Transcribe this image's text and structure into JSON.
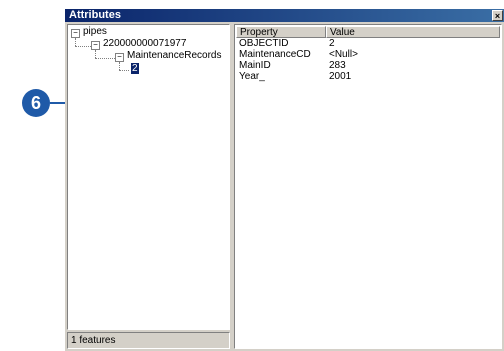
{
  "callout": {
    "number": "6"
  },
  "window": {
    "title": "Attributes",
    "close_glyph": "×"
  },
  "tree": {
    "root": {
      "label": "pipes",
      "expander": "−"
    },
    "feature": {
      "label": "220000000071977",
      "expander": "−"
    },
    "relationship": {
      "label": "MaintenanceRecords",
      "expander": "−"
    },
    "record": {
      "label": "2"
    }
  },
  "status": {
    "text": "1 features"
  },
  "properties": {
    "headers": {
      "property": "Property",
      "value": "Value"
    },
    "rows": [
      {
        "property": "OBJECTID",
        "value": "2"
      },
      {
        "property": "MaintenanceCD",
        "value": "<Null>"
      },
      {
        "property": "MainID",
        "value": "283"
      },
      {
        "property": "Year_",
        "value": "2001"
      }
    ]
  }
}
